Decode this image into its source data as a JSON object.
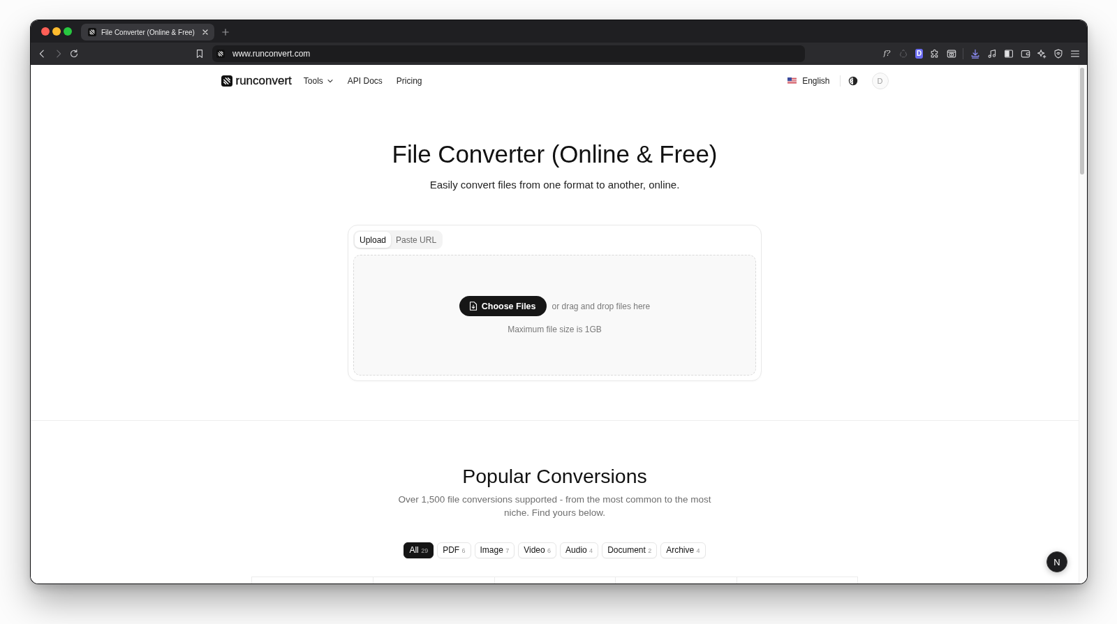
{
  "browser": {
    "tab_title": "File Converter (Online & Free)",
    "url": "www.runconvert.com",
    "extension_labels": [
      "f?",
      "D"
    ]
  },
  "nav": {
    "logo": "runconvert",
    "links": [
      {
        "label": "Tools",
        "kind": "dropdown"
      },
      {
        "label": "API Docs",
        "kind": "link"
      },
      {
        "label": "Pricing",
        "kind": "link"
      }
    ],
    "language": "English",
    "avatar": "D"
  },
  "hero": {
    "title": "File Converter (Online & Free)",
    "subtitle": "Easily convert files from one format to another, online."
  },
  "uploader": {
    "tabs": [
      {
        "label": "Upload",
        "selected": true
      },
      {
        "label": "Paste URL",
        "selected": false
      }
    ],
    "button": "Choose Files",
    "hint": "or drag and drop files here",
    "limit": "Maximum file size is 1GB"
  },
  "popular": {
    "title": "Popular Conversions",
    "description": "Over 1,500 file conversions supported - from the most common to the most niche. Find yours below.",
    "filters": [
      {
        "label": "All",
        "count": "29",
        "selected": true
      },
      {
        "label": "PDF",
        "count": "6",
        "selected": false
      },
      {
        "label": "Image",
        "count": "7",
        "selected": false
      },
      {
        "label": "Video",
        "count": "6",
        "selected": false
      },
      {
        "label": "Audio",
        "count": "4",
        "selected": false
      },
      {
        "label": "Document",
        "count": "2",
        "selected": false
      },
      {
        "label": "Archive",
        "count": "4",
        "selected": false
      }
    ]
  },
  "dev_badge": "N"
}
